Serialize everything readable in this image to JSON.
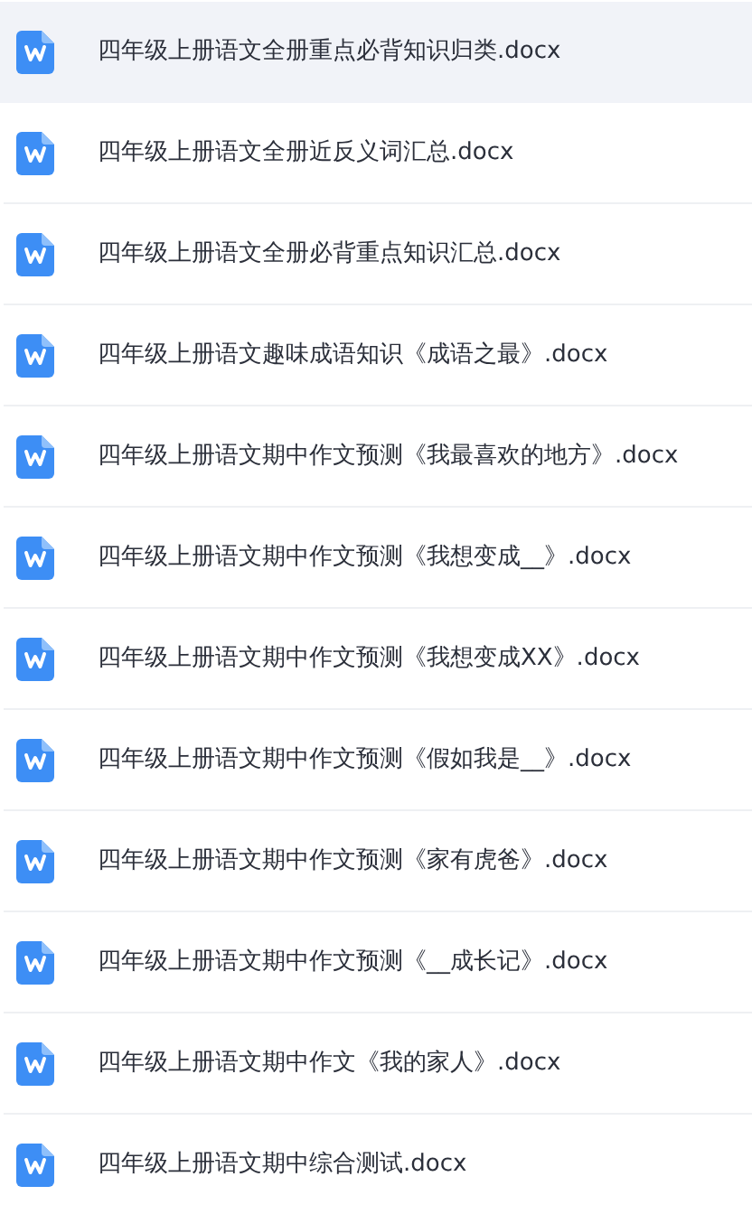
{
  "files": [
    {
      "name": "四年级上册语文全册重点必背知识归类.docx",
      "selected": true
    },
    {
      "name": "四年级上册语文全册近反义词汇总.docx",
      "selected": false
    },
    {
      "name": "四年级上册语文全册必背重点知识汇总.docx",
      "selected": false
    },
    {
      "name": "四年级上册语文趣味成语知识《成语之最》.docx",
      "selected": false
    },
    {
      "name": "四年级上册语文期中作文预测《我最喜欢的地方》.docx",
      "selected": false
    },
    {
      "name": "四年级上册语文期中作文预测《我想变成__》.docx",
      "selected": false
    },
    {
      "name": "四年级上册语文期中作文预测《我想变成XX》.docx",
      "selected": false
    },
    {
      "name": "四年级上册语文期中作文预测《假如我是__》.docx",
      "selected": false
    },
    {
      "name": "四年级上册语文期中作文预测《家有虎爸》.docx",
      "selected": false
    },
    {
      "name": "四年级上册语文期中作文预测《__成长记》.docx",
      "selected": false
    },
    {
      "name": "四年级上册语文期中作文《我的家人》.docx",
      "selected": false
    },
    {
      "name": "四年级上册语文期中综合测试.docx",
      "selected": false
    }
  ]
}
